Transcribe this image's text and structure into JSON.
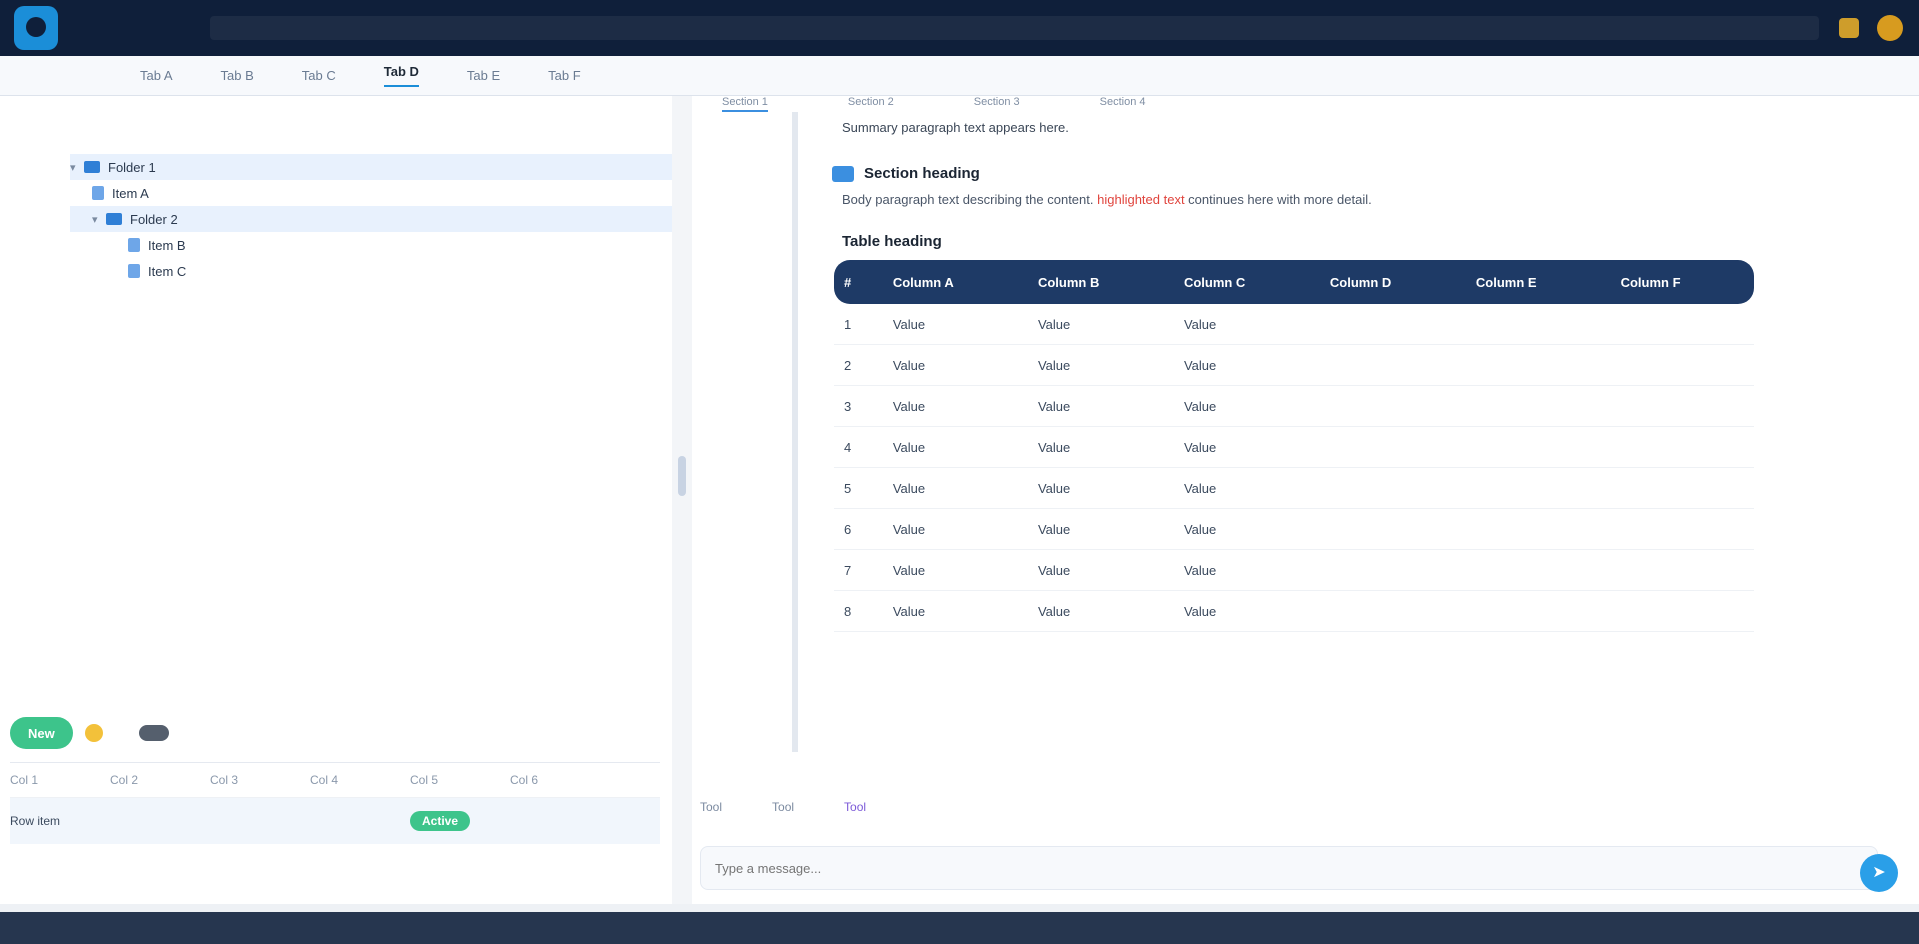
{
  "app": {
    "logo_text": "",
    "search_hint": ""
  },
  "tabs": [
    {
      "label": "Tab A"
    },
    {
      "label": "Tab B"
    },
    {
      "label": "Tab C"
    },
    {
      "label": "Tab D"
    },
    {
      "label": "Tab E"
    },
    {
      "label": "Tab F"
    }
  ],
  "left": {
    "header": "",
    "tree": [
      {
        "label": "Folder 1",
        "type": "folder"
      },
      {
        "label": "Item A",
        "type": "file"
      },
      {
        "label": "Folder 2",
        "type": "folder"
      },
      {
        "label": "Item B",
        "type": "file"
      },
      {
        "label": "Item C",
        "type": "file"
      }
    ],
    "new_button": "New",
    "toolbar_right": "",
    "mini_table": {
      "headers": [
        "Col 1",
        "Col 2",
        "Col 3",
        "Col 4",
        "Col 5",
        "Col 6"
      ],
      "row": {
        "c1": "Row item",
        "c2": "",
        "c3": "",
        "c4": "",
        "status": "Active",
        "c6": ""
      }
    }
  },
  "right": {
    "tabs": [
      "Section 1",
      "Section 2",
      "Section 3",
      "Section 4"
    ],
    "top_paragraph": "Summary paragraph text appears here.",
    "section_title": "Section heading",
    "paragraph": "Body paragraph text describing the content. ",
    "paragraph_highlight": "highlighted text",
    "paragraph_tail": " continues here with more detail.",
    "table_title": "Table heading",
    "table": {
      "headers": [
        "#",
        "Column A",
        "Column B",
        "Column C",
        "Column D",
        "Column E",
        "Column F"
      ],
      "rows": [
        [
          "1",
          "Value",
          "Value",
          "Value",
          "",
          "",
          ""
        ],
        [
          "2",
          "Value",
          "Value",
          "Value",
          "",
          "",
          ""
        ],
        [
          "3",
          "Value",
          "Value",
          "Value",
          "",
          "",
          ""
        ],
        [
          "4",
          "Value",
          "Value",
          "Value",
          "",
          "",
          ""
        ],
        [
          "5",
          "Value",
          "Value",
          "Value",
          "",
          "",
          ""
        ],
        [
          "6",
          "Value",
          "Value",
          "Value",
          "",
          "",
          ""
        ],
        [
          "7",
          "Value",
          "Value",
          "Value",
          "",
          "",
          ""
        ],
        [
          "8",
          "Value",
          "Value",
          "Value",
          "",
          "",
          ""
        ]
      ]
    }
  },
  "chat": {
    "tools": [
      "Tool",
      "Tool",
      "Tool"
    ],
    "placeholder": "Type a message...",
    "send_icon": "send-icon"
  },
  "statusbar": {
    "left": "",
    "middle": "",
    "right": ""
  }
}
